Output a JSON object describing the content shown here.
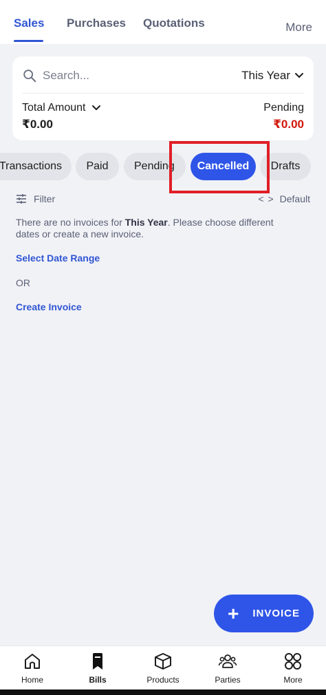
{
  "tabs": {
    "items": [
      {
        "label": "Sales",
        "active": true
      },
      {
        "label": "Purchases",
        "active": false
      },
      {
        "label": "Quotations",
        "active": false
      }
    ],
    "more_label": "More"
  },
  "summary": {
    "search_placeholder": "Search...",
    "period": "This Year",
    "total_label": "Total Amount",
    "total_value": "₹0.00",
    "pending_label": "Pending",
    "pending_value": "₹0.00"
  },
  "chips": [
    {
      "label": "Transactions",
      "active": false
    },
    {
      "label": "Paid",
      "active": false
    },
    {
      "label": "Pending",
      "active": false
    },
    {
      "label": "Cancelled",
      "active": true
    },
    {
      "label": "Drafts",
      "active": false
    }
  ],
  "filter": {
    "label": "Filter",
    "sort_label": "Default"
  },
  "empty_state": {
    "message_start": "There are no invoices for ",
    "message_period": "This Year",
    "message_end": ". Please choose different dates or create a new invoice.",
    "select_date_label": "Select Date Range",
    "or_label": "OR",
    "create_label": "Create Invoice"
  },
  "fab": {
    "label": "INVOICE",
    "icon": "plus-icon"
  },
  "bottom_nav": [
    {
      "label": "Home",
      "icon": "home-icon",
      "active": false
    },
    {
      "label": "Bills",
      "icon": "bookmark-icon",
      "active": true
    },
    {
      "label": "Products",
      "icon": "box-icon",
      "active": false
    },
    {
      "label": "Parties",
      "icon": "users-icon",
      "active": false
    },
    {
      "label": "More",
      "icon": "grid-icon",
      "active": false
    }
  ],
  "colors": {
    "accent": "#2f55e8",
    "pending": "#d1180b",
    "highlight": "#e01e26"
  }
}
